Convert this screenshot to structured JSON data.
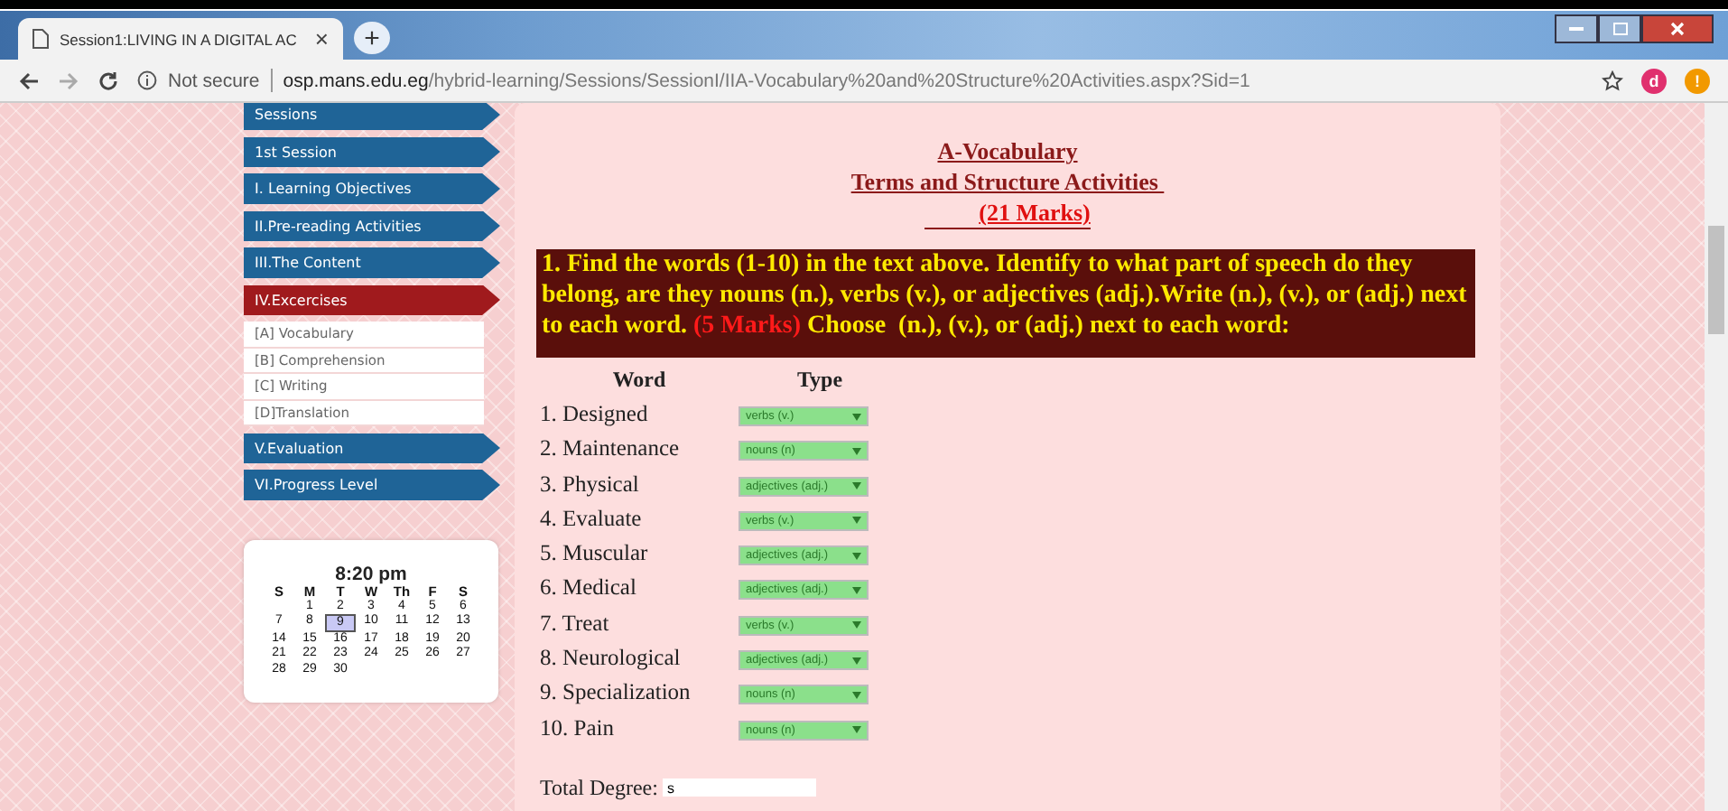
{
  "browser": {
    "tab_title": "Session1:LIVING IN A DIGITAL AC",
    "tab_close": "×",
    "new_tab": "+",
    "security": "Not secure",
    "url_host": "osp.mans.edu.eg",
    "url_path": "/hybrid-learning/Sessions/SessionI/IIA-Vocabulary%20and%20Structure%20Activities.aspx?Sid=1",
    "avatar": "d",
    "alert": "!"
  },
  "sidebar": {
    "items": [
      {
        "label": "Sessions",
        "selected": false
      },
      {
        "label": "1st Session",
        "selected": false
      },
      {
        "label": "I. Learning Objectives",
        "selected": false
      },
      {
        "label": "II.Pre-reading Activities",
        "selected": false
      },
      {
        "label": "III.The Content",
        "selected": false
      },
      {
        "label": "IV.Excercises",
        "selected": true,
        "children": [
          {
            "label": "[A] Vocabulary"
          },
          {
            "label": "[B] Comprehension"
          },
          {
            "label": "[C] Writing"
          },
          {
            "label": "[D]Translation"
          }
        ]
      },
      {
        "label": "V.Evaluation",
        "selected": false
      },
      {
        "label": "VI.Progress Level",
        "selected": false
      }
    ]
  },
  "clock": {
    "time": "8:20 pm",
    "weekdays": [
      "S",
      "M",
      "T",
      "W",
      "Th",
      "F",
      "S"
    ],
    "weeks": [
      [
        {
          "label": "1",
          "selected": false
        },
        {
          "label": "2",
          "selected": false
        },
        {
          "label": "3",
          "selected": false
        },
        {
          "label": "4",
          "selected": false
        },
        {
          "label": "5",
          "selected": false
        },
        {
          "label": "6",
          "selected": false
        }
      ],
      [
        {
          "label": "7",
          "selected": false
        },
        {
          "label": "8",
          "selected": false
        },
        {
          "label": "9",
          "selected": true
        },
        {
          "label": "10",
          "selected": false
        },
        {
          "label": "11",
          "selected": false
        },
        {
          "label": "12",
          "selected": false
        },
        {
          "label": "13",
          "selected": false
        }
      ],
      [
        {
          "label": "14",
          "selected": false
        },
        {
          "label": "15",
          "selected": false
        },
        {
          "label": "16",
          "selected": false
        },
        {
          "label": "17",
          "selected": false
        },
        {
          "label": "18",
          "selected": false
        },
        {
          "label": "19",
          "selected": false
        },
        {
          "label": "20",
          "selected": false
        }
      ],
      [
        {
          "label": "21",
          "selected": false
        },
        {
          "label": "22",
          "selected": false
        },
        {
          "label": "23",
          "selected": false
        },
        {
          "label": "24",
          "selected": false
        },
        {
          "label": "25",
          "selected": false
        },
        {
          "label": "26",
          "selected": false
        },
        {
          "label": "27",
          "selected": false
        }
      ],
      [
        {
          "label": "28",
          "selected": false
        },
        {
          "label": "29",
          "selected": false
        },
        {
          "label": "30",
          "selected": false
        }
      ]
    ]
  },
  "content": {
    "title": "A-Vocabulary",
    "subtitle": "Terms and Structure Activities ",
    "marks": "(21 Marks)",
    "instruction_parts": [
      {
        "text": "1. Find the words (1-10) in the text above. Identify to what part of speech do they belong, are they nouns (n.), verbs (v.), or adjectives (adj.).Write (n.), (v.), or (adj.) next to each word. ",
        "kind": "plain"
      },
      {
        "text": "(5 Marks)",
        "kind": "marks"
      },
      {
        "text": " Choose  (n.), (v.), or (adj.) next to each word:",
        "kind": "plain"
      }
    ],
    "columns": [
      "Word",
      "Type"
    ],
    "rows": [
      {
        "word": "1. Designed",
        "type": "verbs (v.)"
      },
      {
        "word": "2. Maintenance",
        "type": "nouns (n)"
      },
      {
        "word": "3. Physical",
        "type": "adjectives (adj.)"
      },
      {
        "word": "4. Evaluate",
        "type": "verbs (v.)"
      },
      {
        "word": "5. Muscular",
        "type": "adjectives (adj.)"
      },
      {
        "word": "6. Medical",
        "type": "adjectives (adj.)"
      },
      {
        "word": "7. Treat",
        "type": "verbs (v.)"
      },
      {
        "word": "8. Neurological",
        "type": "adjectives (adj.)"
      },
      {
        "word": "9. Specialization",
        "type": "nouns (n)"
      },
      {
        "word": "10. Pain",
        "type": "nouns (n)"
      }
    ],
    "total_label": "Total Degree:",
    "total_value": "s"
  }
}
